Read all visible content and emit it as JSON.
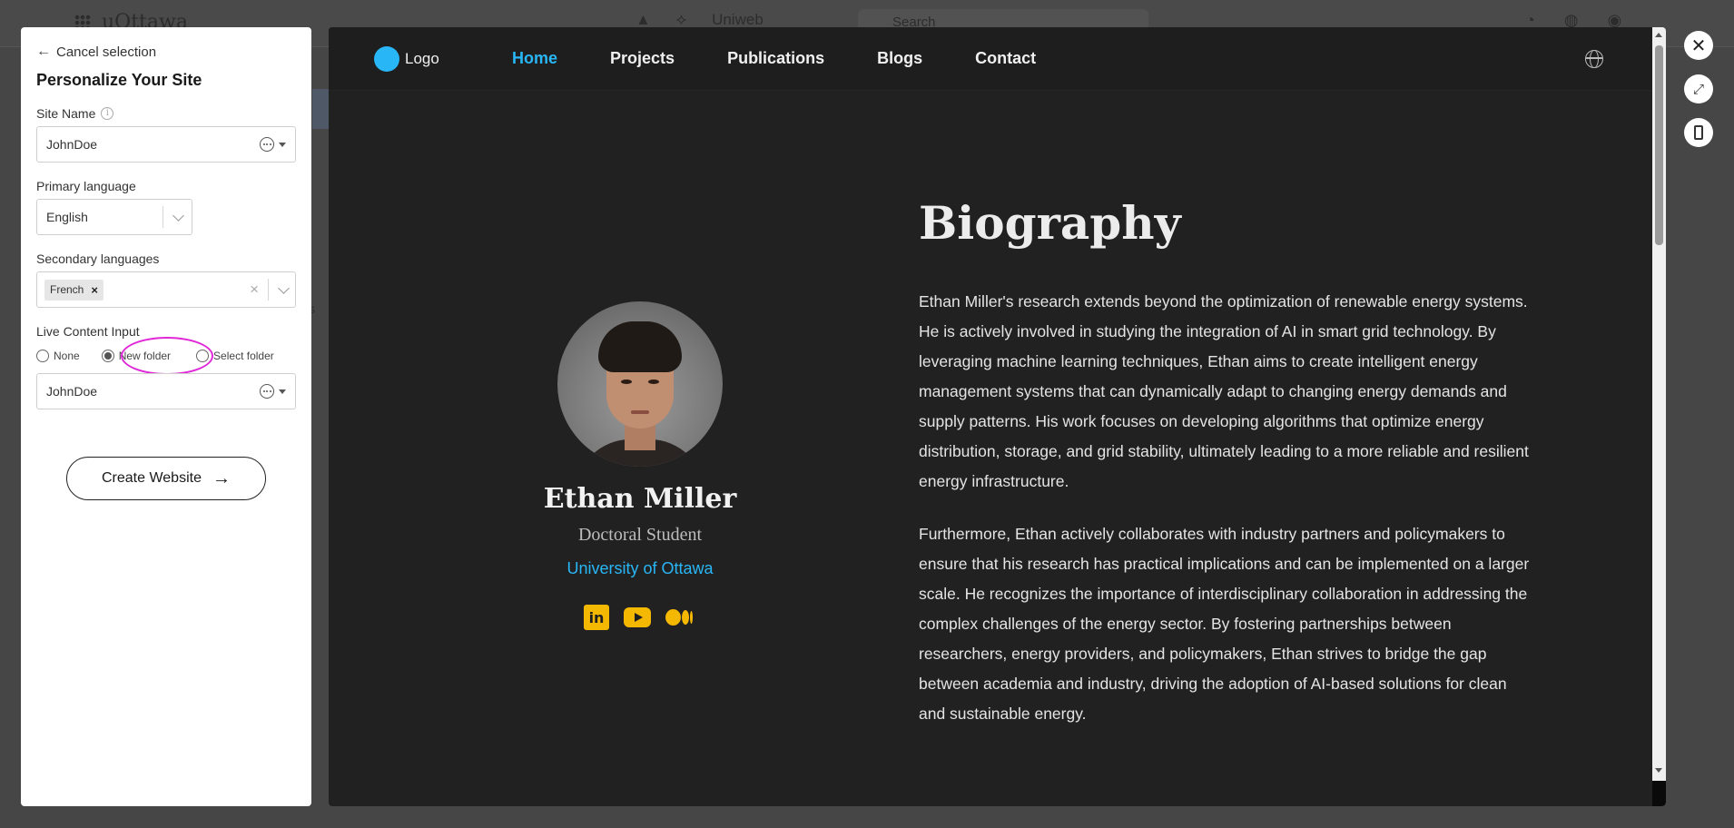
{
  "background_app": {
    "title": "uOttawa",
    "workspace_label": "Uniweb",
    "search_placeholder": "Search"
  },
  "panel": {
    "cancel_label": "Cancel selection",
    "title": "Personalize Your Site",
    "site_name": {
      "label": "Site Name",
      "value": "JohnDoe"
    },
    "primary_language": {
      "label": "Primary language",
      "value": "English"
    },
    "secondary_languages": {
      "label": "Secondary languages",
      "chips": [
        "French"
      ]
    },
    "live_content": {
      "label": "Live Content Input",
      "options": [
        "None",
        "New folder",
        "Select folder"
      ],
      "selected": "New folder",
      "folder_value": "JohnDoe"
    },
    "create_button": "Create Website"
  },
  "site": {
    "logo": "Logo",
    "nav": [
      "Home",
      "Projects",
      "Publications",
      "Blogs",
      "Contact"
    ],
    "active_nav": "Home",
    "person": {
      "name": "Ethan Miller",
      "role": "Doctoral Student",
      "organization": "University of Ottawa"
    },
    "socials": [
      "linkedin-icon",
      "youtube-icon",
      "medium-icon"
    ],
    "bio_heading": "Biography",
    "bio_paragraphs": [
      "Ethan Miller's research extends beyond the optimization of renewable energy systems. He is actively involved in studying the integration of AI in smart grid technology. By leveraging machine learning techniques, Ethan aims to create intelligent energy management systems that can dynamically adapt to changing energy demands and supply patterns. His work focuses on developing algorithms that optimize energy distribution, storage, and grid stability, ultimately leading to a more reliable and resilient energy infrastructure.",
      "Furthermore, Ethan actively collaborates with industry partners and policymakers to ensure that his research has practical implications and can be implemented on a larger scale. He recognizes the importance of interdisciplinary collaboration in addressing the complex challenges of the energy sector. By fostering partnerships between researchers, energy providers, and policymakers, Ethan strives to bridge the gap between academia and industry, driving the adoption of AI-based solutions for clean and sustainable energy."
    ]
  },
  "colors": {
    "accent": "#29b6f6",
    "social": "#f5b800",
    "highlight": "#e028d8",
    "preview_bg": "#212121"
  }
}
